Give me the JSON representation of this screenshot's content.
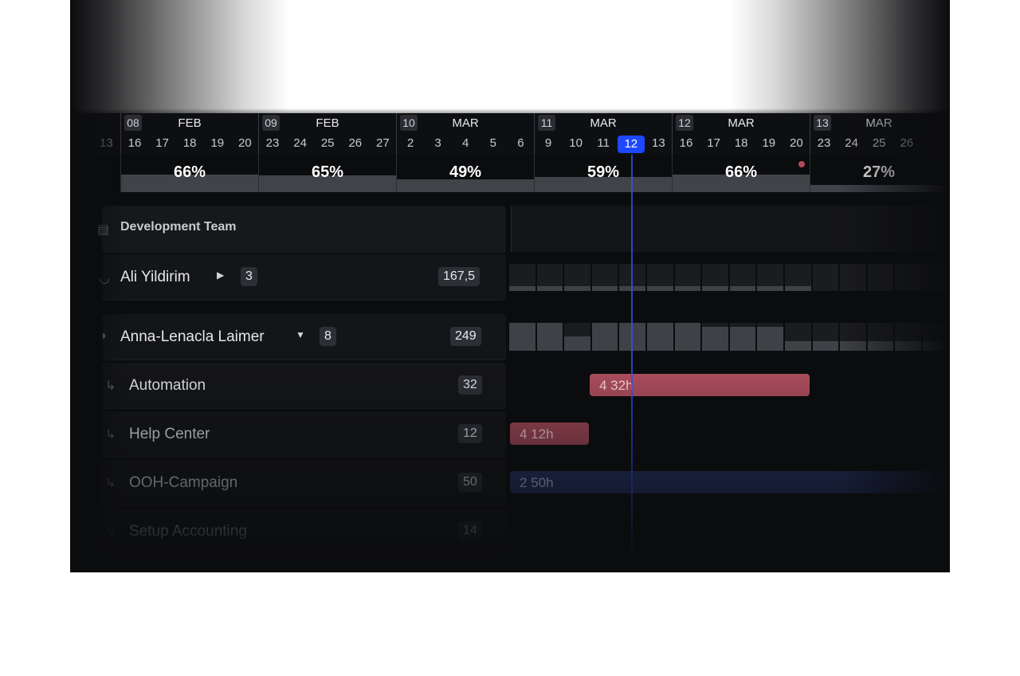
{
  "weeks": [
    {
      "num": "08",
      "month": "FEB",
      "days": [
        "16",
        "17",
        "18",
        "19",
        "20"
      ]
    },
    {
      "num": "09",
      "month": "FEB",
      "days": [
        "23",
        "24",
        "25",
        "26",
        "27"
      ]
    },
    {
      "num": "10",
      "month": "MAR",
      "days": [
        "2",
        "3",
        "4",
        "5",
        "6"
      ]
    },
    {
      "num": "11",
      "month": "MAR",
      "days": [
        "9",
        "10",
        "11",
        "12",
        "13"
      ]
    },
    {
      "num": "12",
      "month": "MAR",
      "days": [
        "16",
        "17",
        "18",
        "19",
        "20"
      ]
    },
    {
      "num": "13",
      "month": "MAR",
      "days": [
        "23",
        "24",
        "25",
        "26"
      ]
    }
  ],
  "partial_day_left": "13",
  "today": "12",
  "utilization": [
    {
      "label": "66%",
      "value": 0.66
    },
    {
      "label": "65%",
      "value": 0.65
    },
    {
      "label": "49%",
      "value": 0.49
    },
    {
      "label": "59%",
      "value": 0.59
    },
    {
      "label": "66%",
      "value": 0.66
    },
    {
      "label": "27%",
      "value": 0.27
    }
  ],
  "team": {
    "name": "Development Team",
    "icon": "building-icon"
  },
  "members": [
    {
      "name": "Ali Yildirim",
      "count": "3",
      "hours": "167,5",
      "expanded": false
    },
    {
      "name": "Anna-Lenacla Laimer",
      "count": "8",
      "hours": "249",
      "expanded": true
    }
  ],
  "projects": [
    {
      "name": "Automation",
      "hours": "32",
      "bar_label": "4  32h"
    },
    {
      "name": "Help Center",
      "hours": "12",
      "bar_label": "4  12h"
    },
    {
      "name": "OOH-Campaign",
      "hours": "50",
      "bar_label": "2  50h"
    },
    {
      "name": "Setup Accounting",
      "hours": "14"
    }
  ],
  "colors": {
    "accent": "#1f47ff",
    "bar_red": "#b04f5f",
    "bar_blue": "#25356f",
    "panel": "#141518"
  }
}
